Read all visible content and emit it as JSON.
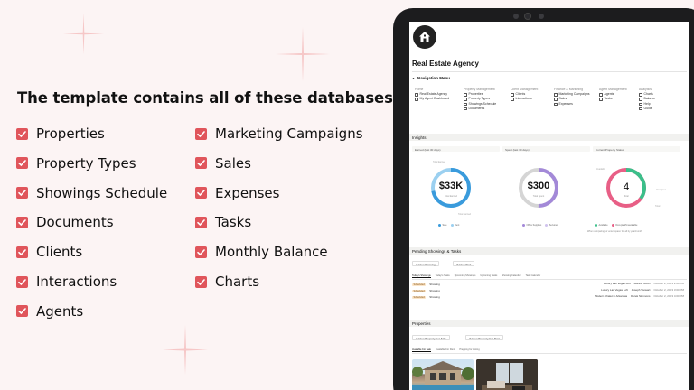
{
  "left": {
    "title": "The template contains all of these databases:",
    "items_col1": [
      "Properties",
      "Property Types",
      "Showings Schedule",
      "Documents",
      "Clients",
      "Interactions",
      "Agents"
    ],
    "items_col2": [
      "Marketing Campaigns",
      "Sales",
      "Expenses",
      "Tasks",
      "Monthly Balance",
      "Charts"
    ]
  },
  "colors": {
    "accent": "#e0555b",
    "gauge_blue": "#3a9bdc",
    "gauge_purple": "#a389d8",
    "gauge_green": "#3bbf8a",
    "background": "#fcf4f4"
  },
  "screen": {
    "title": "Real Estate Agency",
    "nav_heading": "Navigation Menu",
    "nav_columns": [
      {
        "heading": "Home",
        "items": [
          "Real Estate Agency",
          "My Agent Dashboard"
        ]
      },
      {
        "heading": "Property Management",
        "items": [
          "Properties",
          "Property Types",
          "Showings Schedule",
          "Documents"
        ]
      },
      {
        "heading": "Client Management",
        "items": [
          "Clients",
          "Interactions"
        ]
      },
      {
        "heading": "Finance & Marketing",
        "items": [
          "Marketing Campaigns",
          "Sales",
          "Expenses"
        ]
      },
      {
        "heading": "Agent Management",
        "items": [
          "Agents",
          "Tasks"
        ]
      },
      {
        "heading": "Analytics",
        "items": [
          "Charts",
          "Balance",
          "Help",
          "Guide"
        ]
      }
    ],
    "insights": {
      "heading": "Insights",
      "kpi_labels": [
        "Earned (last 30 days)",
        "Spent (last 30 days)",
        "Current Property Status"
      ],
      "gauges": [
        {
          "value": "$33K",
          "sub": "Total Earned",
          "percent": 0.72
        },
        {
          "value": "$300",
          "sub": "Total Spent",
          "percent": 0.5
        },
        {
          "value": "4",
          "sub": "Total",
          "percent": 0.35
        }
      ],
      "legend1": [
        "Sale",
        "Rent"
      ],
      "legend2": [
        "Office Supplies",
        "Services"
      ],
      "legend3": [
        "Available",
        "Occupied/Unavailable"
      ],
      "note": "When comparing, or enter 'space' for all by year/month"
    },
    "pending": {
      "heading": "Pending Showings & Tasks",
      "buttons": [
        "New Showing",
        "New Task"
      ],
      "tabs": [
        "Today's Showings",
        "Today's Tasks",
        "Upcoming Showings",
        "Upcoming Tasks",
        "Showing Calendar",
        "Task Calendar"
      ],
      "rows": [
        {
          "tag": "Scheduled",
          "type": "Showing",
          "property": "Luxury Las Vegas Loft",
          "agent": "Martha Smith",
          "date": "October 2, 2023 2:00 PM"
        },
        {
          "tag": "Scheduled",
          "type": "Showing",
          "property": "Luxury Las Vegas Loft",
          "agent": "Joseph Stewart",
          "date": "October 2, 2023 3:00 PM"
        },
        {
          "tag": "Scheduled",
          "type": "Showing",
          "property": "Modern Chalet in Arkansas",
          "agent": "Derek Simmons",
          "date": "October 2, 2023 4:00 PM"
        }
      ]
    },
    "properties": {
      "heading": "Properties",
      "buttons": [
        "New Property For Sale",
        "New Property For Rent"
      ],
      "tabs": [
        "Available For Sale",
        "Available For Rent",
        "Prepping for Listing"
      ]
    }
  }
}
